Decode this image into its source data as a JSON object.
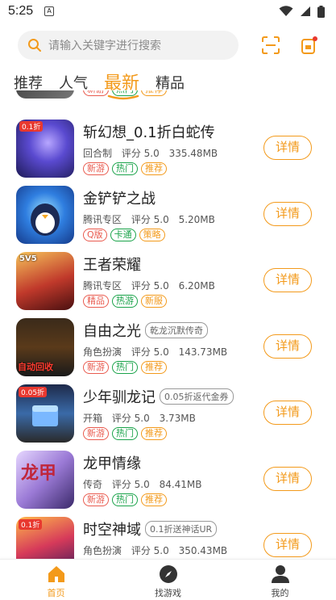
{
  "status_bar": {
    "time": "5:25",
    "sim_glyph": "A"
  },
  "search": {
    "placeholder": "请输入关键字进行搜索"
  },
  "tabs": [
    {
      "label": "推荐",
      "active": false
    },
    {
      "label": "人气",
      "active": false
    },
    {
      "label": "最新",
      "active": true
    },
    {
      "label": "精品",
      "active": false
    }
  ],
  "partial_item": {
    "tags": [
      {
        "text": "新游",
        "color": "red"
      },
      {
        "text": "热门",
        "color": "green"
      },
      {
        "text": "推荐",
        "color": "orange"
      }
    ]
  },
  "games": [
    {
      "name": "斩幻想_0.1折白蛇传",
      "promo": "",
      "category": "回合制",
      "score": "评分 5.0",
      "size": "335.48MB",
      "tags": [
        {
          "text": "新游",
          "color": "red"
        },
        {
          "text": "热门",
          "color": "green"
        },
        {
          "text": "推荐",
          "color": "orange"
        }
      ],
      "cover_badge": "0.1折",
      "button": "详情"
    },
    {
      "name": "金铲铲之战",
      "promo": "",
      "category": "腾讯专区",
      "score": "评分 5.0",
      "size": "5.20MB",
      "tags": [
        {
          "text": "Q版",
          "color": "red"
        },
        {
          "text": "卡通",
          "color": "green"
        },
        {
          "text": "策略",
          "color": "orange"
        }
      ],
      "cover_badge": "",
      "button": "详情"
    },
    {
      "name": "王者荣耀",
      "promo": "",
      "category": "腾讯专区",
      "score": "评分 5.0",
      "size": "6.20MB",
      "tags": [
        {
          "text": "精品",
          "color": "red"
        },
        {
          "text": "热游",
          "color": "green"
        },
        {
          "text": "新服",
          "color": "orange"
        }
      ],
      "cover_badge": "5V5",
      "button": "详情"
    },
    {
      "name": "自由之光",
      "promo": "乾龙沉默传奇",
      "category": "角色扮演",
      "score": "评分 5.0",
      "size": "143.73MB",
      "tags": [
        {
          "text": "新游",
          "color": "red"
        },
        {
          "text": "热门",
          "color": "green"
        },
        {
          "text": "推荐",
          "color": "orange"
        }
      ],
      "cover_badge": "自动回收",
      "button": "详情"
    },
    {
      "name": "少年驯龙记",
      "promo": "0.05折返代金券",
      "category": "开箱",
      "score": "评分 5.0",
      "size": "3.73MB",
      "tags": [
        {
          "text": "新游",
          "color": "red"
        },
        {
          "text": "热门",
          "color": "green"
        },
        {
          "text": "推荐",
          "color": "orange"
        }
      ],
      "cover_badge": "0.05折",
      "button": "详情"
    },
    {
      "name": "龙甲情缘",
      "promo": "",
      "category": "传奇",
      "score": "评分 5.0",
      "size": "84.41MB",
      "tags": [
        {
          "text": "新游",
          "color": "red"
        },
        {
          "text": "热门",
          "color": "green"
        },
        {
          "text": "推荐",
          "color": "orange"
        }
      ],
      "cover_badge": "龙甲",
      "button": "详情"
    },
    {
      "name": "时空神域",
      "promo": "0.1折送神话UR",
      "category": "角色扮演",
      "score": "评分 5.0",
      "size": "350.43MB",
      "tags": [],
      "cover_badge": "0.1折",
      "button": "详情"
    }
  ],
  "bottom_nav": [
    {
      "label": "首页",
      "icon": "home-icon",
      "active": true
    },
    {
      "label": "找游戏",
      "icon": "compass-icon",
      "active": false
    },
    {
      "label": "我的",
      "icon": "user-icon",
      "active": false
    }
  ],
  "colors": {
    "accent": "#f39a1b",
    "tag_red": "#e95b4f",
    "tag_green": "#1aa34a"
  }
}
